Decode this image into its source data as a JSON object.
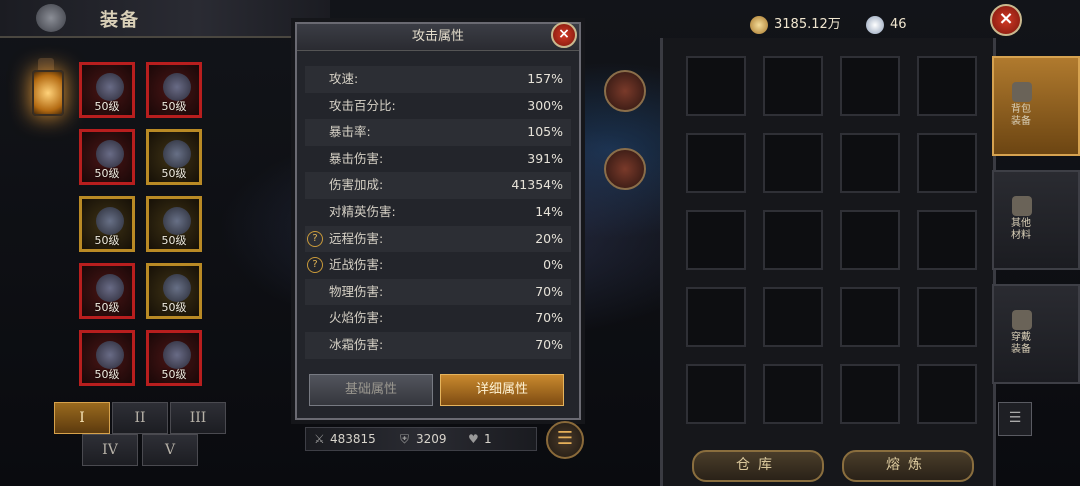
{
  "header": {
    "title": "装备"
  },
  "equipment": {
    "slots": [
      {
        "level": "50级",
        "rarity": "red"
      },
      {
        "level": "50级",
        "rarity": "red"
      },
      {
        "level": "50级",
        "rarity": "red"
      },
      {
        "level": "50级",
        "rarity": "gold"
      },
      {
        "level": "50级",
        "rarity": "gold"
      },
      {
        "level": "50级",
        "rarity": "gold"
      },
      {
        "level": "50级",
        "rarity": "red"
      },
      {
        "level": "50级",
        "rarity": "gold"
      },
      {
        "level": "50级",
        "rarity": "red"
      },
      {
        "level": "50级",
        "rarity": "red"
      }
    ],
    "pages": [
      "I",
      "II",
      "III",
      "IV",
      "V"
    ],
    "active_page": "I"
  },
  "stats_modal": {
    "title": "攻击属性",
    "close_label": "×",
    "rows": [
      {
        "label": "攻速:",
        "value": "157%",
        "help": false
      },
      {
        "label": "攻击百分比:",
        "value": "300%",
        "help": false
      },
      {
        "label": "暴击率:",
        "value": "105%",
        "help": false
      },
      {
        "label": "暴击伤害:",
        "value": "391%",
        "help": false
      },
      {
        "label": "伤害加成:",
        "value": "41354%",
        "help": false
      },
      {
        "label": "对精英伤害:",
        "value": "14%",
        "help": false
      },
      {
        "label": "远程伤害:",
        "value": "20%",
        "help": true
      },
      {
        "label": "近战伤害:",
        "value": "0%",
        "help": true
      },
      {
        "label": "物理伤害:",
        "value": "70%",
        "help": false
      },
      {
        "label": "火焰伤害:",
        "value": "70%",
        "help": false
      },
      {
        "label": "冰霜伤害:",
        "value": "70%",
        "help": false
      }
    ],
    "help_glyph": "?",
    "basic_button": "基础属性",
    "detail_button": "详细属性"
  },
  "power_bar": {
    "attack": "483815",
    "defense": "3209",
    "hearts": "1"
  },
  "menu_glyph": "☰",
  "currency": {
    "gold": "3185.12万",
    "gems": "46"
  },
  "close_label": "×",
  "inventory_tabs": [
    {
      "label": "背包装备",
      "active": true
    },
    {
      "label": "其他材料",
      "active": false
    },
    {
      "label": "穿戴装备",
      "active": false
    }
  ],
  "filter_glyph": "☰",
  "bottom_buttons": {
    "warehouse": "仓库",
    "smelt": "熔炼"
  },
  "colors": {
    "accent": "#c9892e",
    "rarity_red": "#b81e1e",
    "rarity_gold": "#b98a25"
  }
}
